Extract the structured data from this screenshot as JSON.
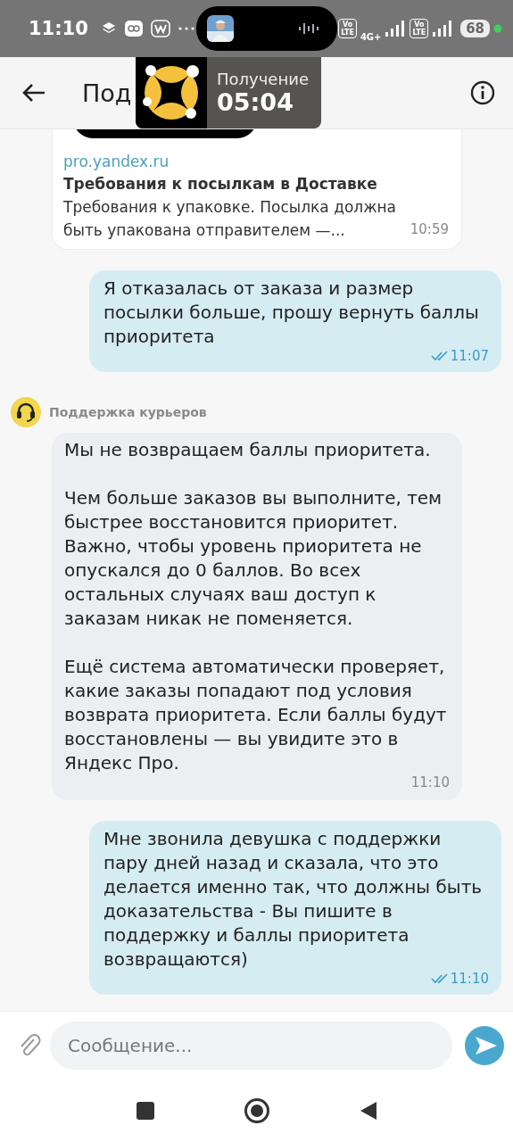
{
  "status_bar": {
    "time": "11:10",
    "volte_badges": [
      "Vo\nLTE",
      "Vo\nLTE"
    ],
    "network": "4G+",
    "battery": "68"
  },
  "header": {
    "title_start": "Под"
  },
  "overlay": {
    "label": "Получение",
    "timer": "05:04"
  },
  "messages": [
    {
      "kind": "link",
      "domain": "pro.yandex.ru",
      "title": "Требования к посылкам в Доставке",
      "description": "Требования к упаковке. Посылка должна быть упакована отправителем —...",
      "time": "10:59"
    },
    {
      "kind": "text",
      "outgoing": true,
      "paragraphs": [
        "Я отказалась от заказа и размер посылки больше, прошу вернуть баллы приоритета"
      ],
      "time": "11:07",
      "read": true
    },
    {
      "kind": "sender",
      "name": "Поддержка курьеров"
    },
    {
      "kind": "text",
      "outgoing": false,
      "paragraphs": [
        "Мы не возвращаем баллы приоритета.",
        "Чем больше заказов вы выполните, тем быстрее восстановится приоритет. Важно, чтобы уровень приоритета не опускался до 0 баллов. Во всех остальных случаях ваш доступ к заказам никак не поменяется.",
        "Ещё система автоматически проверяет, какие заказы попадают под условия возврата приоритета. Если баллы будут восстановлены — вы увидите это в Яндекс Про."
      ],
      "time": "11:10"
    },
    {
      "kind": "text",
      "outgoing": true,
      "paragraphs": [
        "Мне звонила девушка с поддержки пару дней назад и сказала, что это делается именно так, что должны быть доказательства - Вы пишите в поддержку и баллы приоритета возвращаются)"
      ],
      "time": "11:10",
      "read": true
    }
  ],
  "composer": {
    "placeholder": "Сообщение..."
  }
}
